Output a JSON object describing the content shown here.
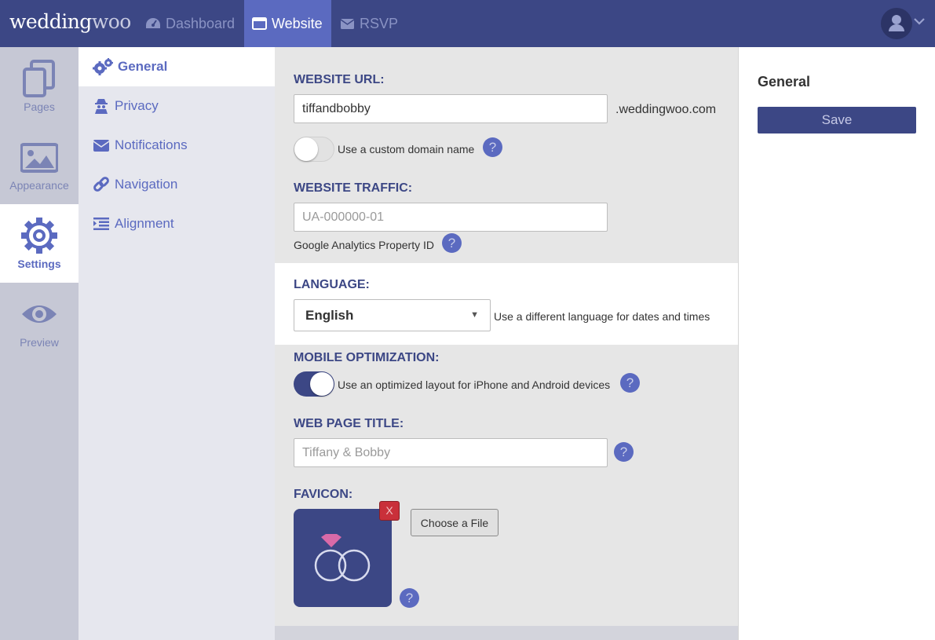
{
  "header": {
    "logo_main": "wedding",
    "logo_accent": "woo",
    "nav": [
      {
        "label": "Dashboard",
        "icon": "dashboard-gauge-icon"
      },
      {
        "label": "Website",
        "icon": "browser-window-icon",
        "active": true
      },
      {
        "label": "RSVP",
        "icon": "envelope-icon"
      }
    ],
    "user_icon": "user-avatar-icon",
    "menu_icon": "chevron-down-icon"
  },
  "iconbar": {
    "items": [
      {
        "label": "Pages",
        "icon": "pages-icon"
      },
      {
        "label": "Appearance",
        "icon": "image-icon"
      },
      {
        "label": "Settings",
        "icon": "gear-icon",
        "active": true
      },
      {
        "label": "Preview",
        "icon": "eye-icon"
      }
    ]
  },
  "subnav": {
    "items": [
      {
        "label": "General",
        "icon": "gears-icon",
        "active": true
      },
      {
        "label": "Privacy",
        "icon": "spy-icon"
      },
      {
        "label": "Notifications",
        "icon": "envelope-icon"
      },
      {
        "label": "Navigation",
        "icon": "link-icon"
      },
      {
        "label": "Alignment",
        "icon": "indent-icon"
      }
    ]
  },
  "form": {
    "url_label": "WEBSITE URL:",
    "url_value": "tiffandbobby",
    "url_suffix": ".weddingwoo.com",
    "custom_domain_label": "Use a custom domain name",
    "custom_domain_on": false,
    "traffic_label": "WEBSITE TRAFFIC:",
    "traffic_placeholder": "UA-000000-01",
    "traffic_help": "Google Analytics Property ID",
    "language_label": "LANGUAGE:",
    "language_value": "English",
    "language_help": "Use a different language for dates and times",
    "mobile_label": "MOBILE OPTIMIZATION:",
    "mobile_help": "Use an optimized layout for iPhone and Android devices",
    "mobile_on": true,
    "title_label": "WEB PAGE TITLE:",
    "title_placeholder": "Tiffany & Bobby",
    "favicon_label": "FAVICON:",
    "favicon_remove": "X",
    "choose_file": "Choose a File",
    "help_glyph": "?"
  },
  "right_panel": {
    "title": "General",
    "save_label": "Save"
  },
  "colors": {
    "brand": "#3c4785",
    "accent": "#5b6ac0",
    "danger": "#c9303a"
  }
}
